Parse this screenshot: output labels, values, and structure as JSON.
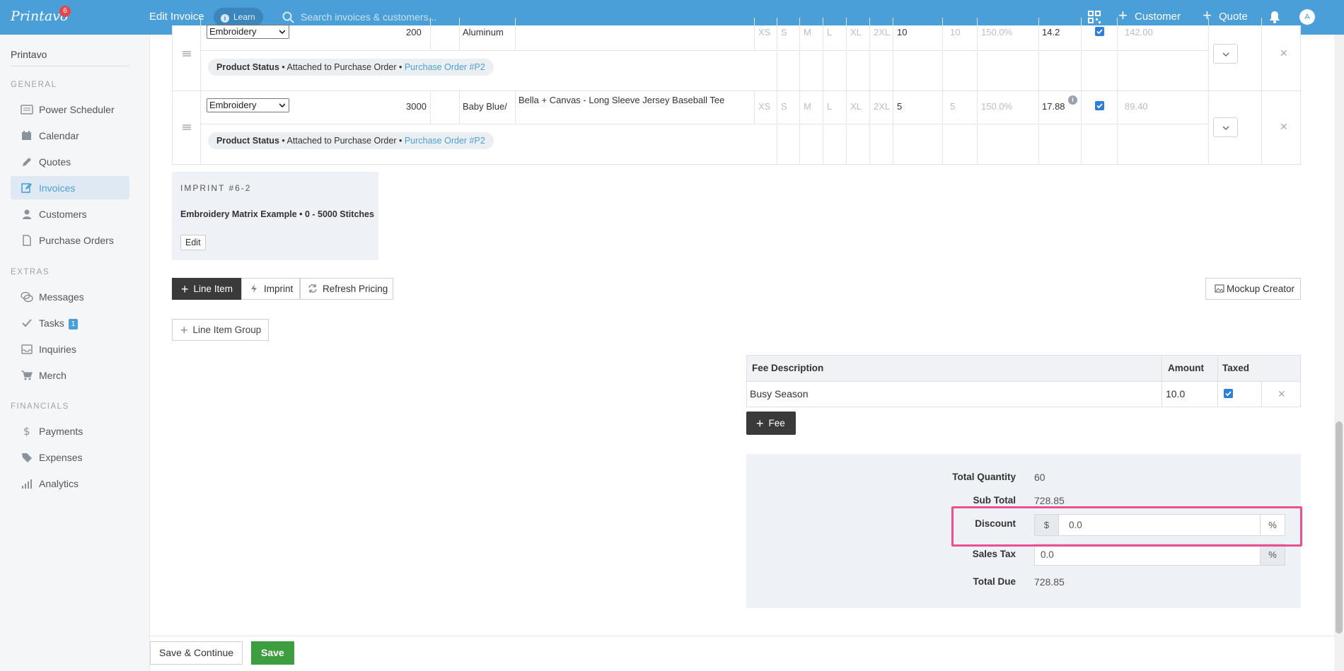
{
  "topbar": {
    "brand": "Printavo",
    "brand_badge": "6",
    "title": "Edit Invoice",
    "learn": "Learn",
    "search_placeholder": "Search invoices & customers...",
    "customer_link": "Customer",
    "quote_link": "Quote",
    "avatar": "A"
  },
  "sidebar": {
    "org": "Printavo",
    "sections": {
      "general": "GENERAL",
      "extras": "EXTRAS",
      "financials": "FINANCIALS"
    },
    "items": [
      {
        "label": "Power Scheduler",
        "icon": "scheduler-icon"
      },
      {
        "label": "Calendar",
        "icon": "calendar-icon"
      },
      {
        "label": "Quotes",
        "icon": "pencil-icon"
      },
      {
        "label": "Invoices",
        "icon": "edit-icon",
        "active": true
      },
      {
        "label": "Customers",
        "icon": "user-icon"
      },
      {
        "label": "Purchase Orders",
        "icon": "document-icon"
      },
      {
        "label": "Messages",
        "icon": "chat-icon"
      },
      {
        "label": "Tasks",
        "icon": "check-icon",
        "count": "1"
      },
      {
        "label": "Inquiries",
        "icon": "inbox-icon"
      },
      {
        "label": "Merch",
        "icon": "cart-icon"
      },
      {
        "label": "Payments",
        "icon": "dollar-icon"
      },
      {
        "label": "Expenses",
        "icon": "tag-icon"
      },
      {
        "label": "Analytics",
        "icon": "bars-icon"
      }
    ]
  },
  "line_items": [
    {
      "category": "Embroidery",
      "item_number": "200",
      "color": "Aluminum",
      "description": "",
      "sizes": [
        "XS",
        "S",
        "M",
        "L",
        "XL",
        "2XL"
      ],
      "quantity": "10",
      "total_qty": "10",
      "markup": "150.0%",
      "price": "14.2",
      "taxed": true,
      "total": "142.00",
      "status_label": "Product Status",
      "status_text": "• Attached to Purchase Order •",
      "po_link": "Purchase Order #P2"
    },
    {
      "category": "Embroidery",
      "item_number": "3000",
      "color": "Baby Blue/",
      "description": "Bella + Canvas - Long Sleeve Jersey Baseball Tee",
      "sizes": [
        "XS",
        "S",
        "M",
        "L",
        "XL",
        "2XL"
      ],
      "quantity": "5",
      "total_qty": "5",
      "markup": "150.0%",
      "price": "17.88",
      "taxed": true,
      "total": "89.40",
      "status_label": "Product Status",
      "status_text": "• Attached to Purchase Order •",
      "po_link": "Purchase Order #P2"
    }
  ],
  "imprint": {
    "title": "IMPRINT #6-2",
    "description": "Embroidery Matrix Example • 0 - 5000 Stitches",
    "edit": "Edit"
  },
  "actions": {
    "line_item": "Line Item",
    "imprint": "Imprint",
    "refresh_pricing": "Refresh Pricing",
    "mockup_creator": "Mockup Creator",
    "line_item_group": "Line Item Group"
  },
  "fees": {
    "headers": {
      "description": "Fee Description",
      "amount": "Amount",
      "taxed": "Taxed"
    },
    "rows": [
      {
        "description": "Busy Season",
        "amount": "10.0",
        "taxed": true
      }
    ],
    "add_fee": "Fee"
  },
  "totals": {
    "total_quantity_label": "Total Quantity",
    "total_quantity": "60",
    "sub_total_label": "Sub Total",
    "sub_total": "728.85",
    "discount_label": "Discount",
    "discount_currency": "$",
    "discount_value": "0.0",
    "discount_percent": "%",
    "sales_tax_label": "Sales Tax",
    "sales_tax_value": "0.0",
    "sales_tax_percent": "%",
    "total_due_label": "Total Due",
    "total_due": "728.85"
  },
  "footer": {
    "save_continue": "Save & Continue",
    "save": "Save"
  },
  "colors": {
    "topbar": "#4a9fd8",
    "accent": "#4a9fd8",
    "save_green": "#3d9e3f",
    "highlight": "#ea4f93"
  }
}
